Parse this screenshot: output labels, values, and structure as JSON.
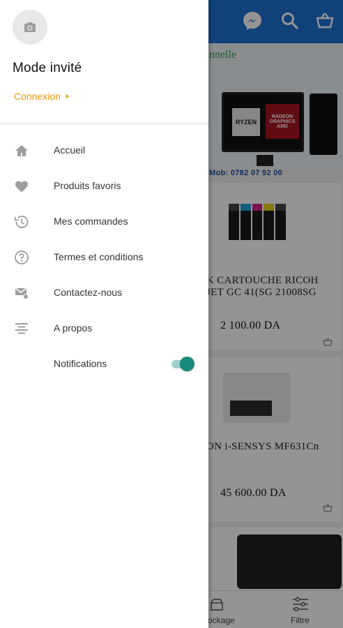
{
  "drawer": {
    "guest_name": "Mode invité",
    "login_label": "Connexion",
    "menu": [
      {
        "label": "Accueil",
        "icon": "home-icon"
      },
      {
        "label": "Produits favoris",
        "icon": "heart-icon"
      },
      {
        "label": "Mes commandes",
        "icon": "history-icon"
      },
      {
        "label": "Termes et conditions",
        "icon": "help-circle-icon"
      },
      {
        "label": "Contactez-nous",
        "icon": "mail-icon"
      },
      {
        "label": "A propos",
        "icon": "align-center-icon"
      },
      {
        "label": "Notifications",
        "icon": "",
        "toggle_on": true
      }
    ]
  },
  "background": {
    "banner": {
      "title": "nnelle",
      "phone": "Mob: 0782 07 92 00",
      "chip1": "RYZEN",
      "chip2": "RADEON GRAPHICS AMD"
    },
    "products": [
      {
        "name_line1": "K CARTOUCHE RICOH",
        "name_line2": "JET GC 41(SG 21008SG",
        "price": "2 100.00 DA"
      },
      {
        "name_line1": "ON i-SENSYS MF631Cn",
        "name_line2": "",
        "price": "45 600.00 DA"
      }
    ],
    "bottom_nav": {
      "left_label": "ockage",
      "right_label": "Filtre"
    }
  },
  "colors": {
    "topbar": "#1e73d2",
    "accent_orange": "#f0940a",
    "toggle_teal": "#168a7c",
    "icon_gray": "#9e9e9e"
  }
}
